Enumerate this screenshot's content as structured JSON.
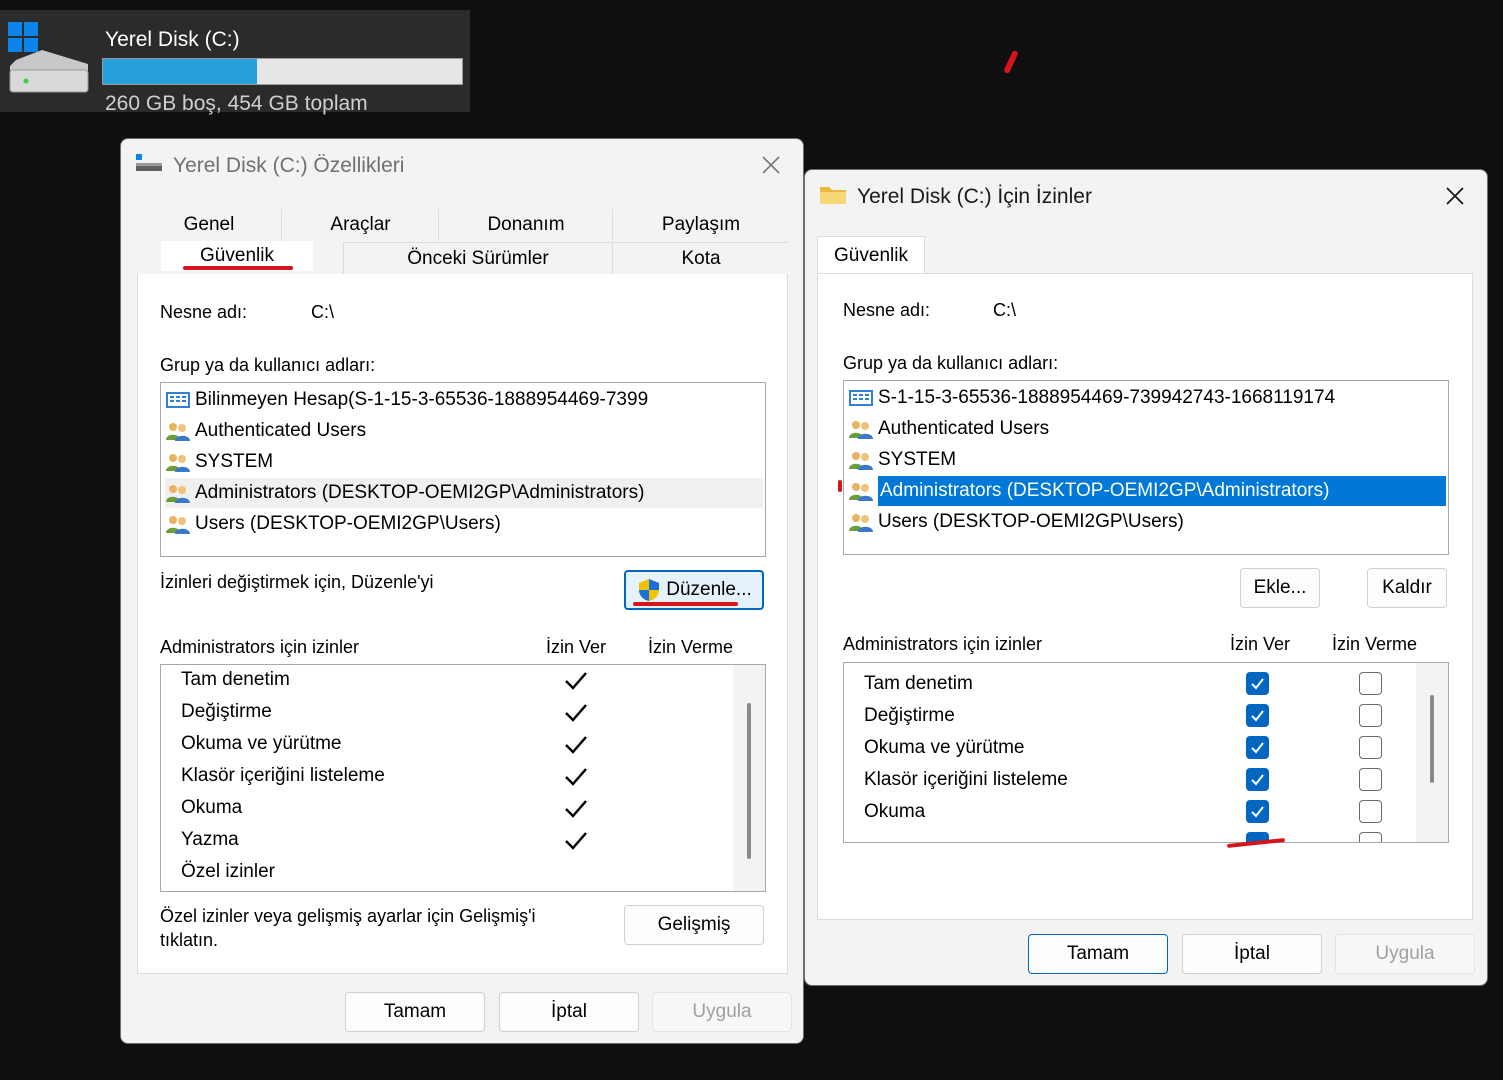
{
  "drive": {
    "name": "Yerel Disk (C:)",
    "space": "260 GB boş, 454 GB toplam",
    "used_fraction": 0.43
  },
  "props": {
    "title": "Yerel Disk (C:) Özellikleri",
    "tabs": {
      "genel": "Genel",
      "araclar": "Araçlar",
      "donanim": "Donanım",
      "paylasim": "Paylaşım",
      "guvenlik": "Güvenlik",
      "onceki": "Önceki Sürümler",
      "kota": "Kota"
    },
    "object_label": "Nesne adı:",
    "object_value": "C:\\",
    "group_label": "Grup ya da kullanıcı adları:",
    "principals": [
      "Bilinmeyen Hesap(S-1-15-3-65536-1888954469-7399",
      "Authenticated Users",
      "SYSTEM",
      "Administrators (DESKTOP-OEMI2GP\\Administrators)",
      "Users (DESKTOP-OEMI2GP\\Users)"
    ],
    "edit_hint": "İzinleri değiştirmek için, Düzenle'yi",
    "edit_button": "Düzenle...",
    "perm_header": "Administrators için izinler",
    "allow_header": "İzin Ver",
    "deny_header": "İzin Verme",
    "permissions": [
      "Tam denetim",
      "Değiştirme",
      "Okuma ve yürütme",
      "Klasör içeriğini listeleme",
      "Okuma",
      "Yazma",
      "Özel izinler"
    ],
    "advanced_hint_1": "Özel izinler veya gelişmiş ayarlar için Gelişmiş'i",
    "advanced_hint_2": "tıklatın.",
    "advanced_button": "Gelişmiş",
    "ok": "Tamam",
    "cancel": "İptal",
    "apply": "Uygula"
  },
  "perms": {
    "title": "Yerel Disk (C:) İçin İzinler",
    "tab": "Güvenlik",
    "object_label": "Nesne adı:",
    "object_value": "C:\\",
    "group_label": "Grup ya da kullanıcı adları:",
    "principals": [
      "S-1-15-3-65536-1888954469-739942743-1668119174",
      "Authenticated Users",
      "SYSTEM",
      "Administrators (DESKTOP-OEMI2GP\\Administrators)",
      "Users (DESKTOP-OEMI2GP\\Users)"
    ],
    "add_button": "Ekle...",
    "remove_button": "Kaldır",
    "perm_header": "Administrators için izinler",
    "allow_header": "İzin Ver",
    "deny_header": "İzin Verme",
    "permissions": [
      "Tam denetim",
      "Değiştirme",
      "Okuma ve yürütme",
      "Klasör içeriğini listeleme",
      "Okuma"
    ],
    "ok": "Tamam",
    "cancel": "İptal",
    "apply": "Uygula"
  },
  "colors": {
    "accent": "#0067c0",
    "selection": "#0078d7",
    "annotation": "#d6141b",
    "progress": "#26a0da"
  }
}
